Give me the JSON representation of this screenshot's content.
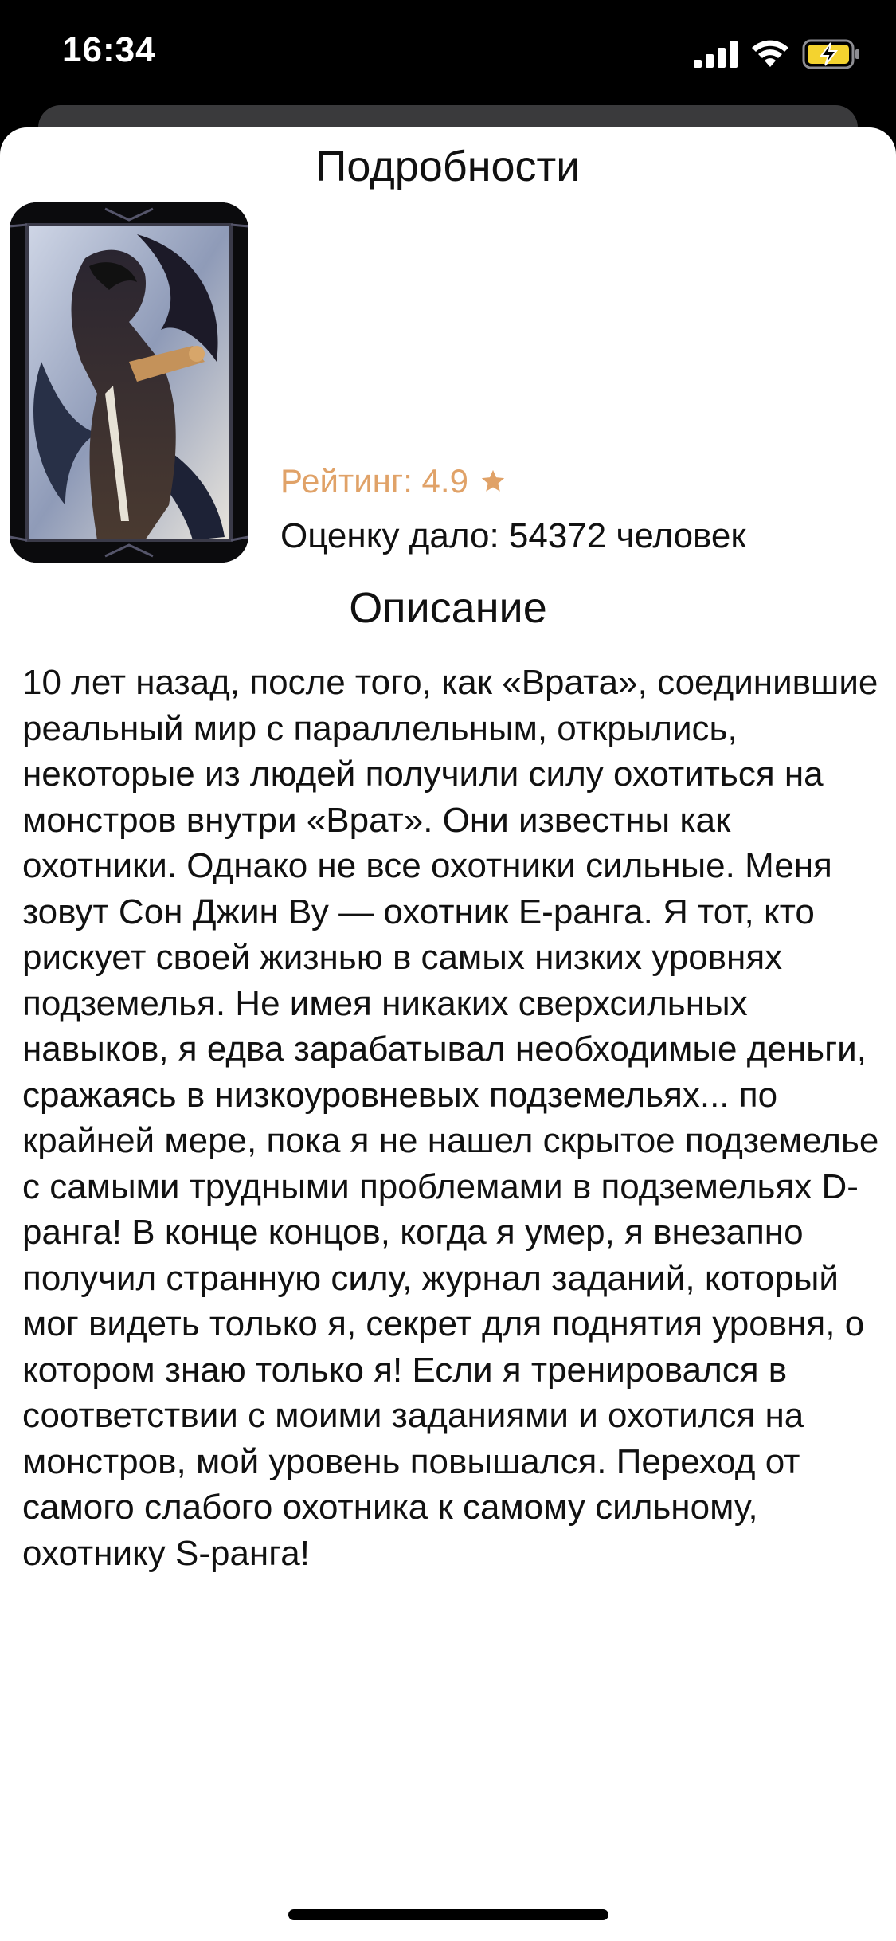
{
  "status_bar": {
    "time": "16:34",
    "icons": [
      "cellular-signal-icon",
      "wifi-icon",
      "battery-charging-icon"
    ],
    "battery_color": "#f4d32f"
  },
  "sheet": {
    "title": "Подробности",
    "cover_icon": "manga-cover-image",
    "rating_label": "Рейтинг: 4.9",
    "rating_icon": "star-icon",
    "rating_color": "#e0a268",
    "ratings_count_label": "Оценку дало: 54372 человек",
    "description_title": "Описание",
    "description_text": "10 лет назад, после того, как «Врата», соединившие реальный мир с параллельным, открылись, некоторые из людей получили силу охотиться на монстров внутри «Врат». Они известны как охотники. Однако не все охотники сильные. Меня зовут Сон Джин Ву — охотник Е-ранга. Я тот, кто рискует своей жизнью в самых низких уровнях подземелья. Не имея никаких сверхсильных навыков, я едва зарабатывал необходимые деньги, сражаясь в низкоуровневых подземельях... по крайней мере, пока я не нашел скрытое подземелье с самыми трудными проблемами в подземельях D-ранга! В конце концов, когда я умер, я внезапно получил странную силу, журнал заданий, который мог видеть только я, секрет для поднятия уровня, о котором знаю только я! Если я тренировался в соответствии с моими заданиями и охотился на монстров, мой уровень повышался. Переход от самого слабого охотника к самому сильному, охотнику S-ранга!"
  }
}
